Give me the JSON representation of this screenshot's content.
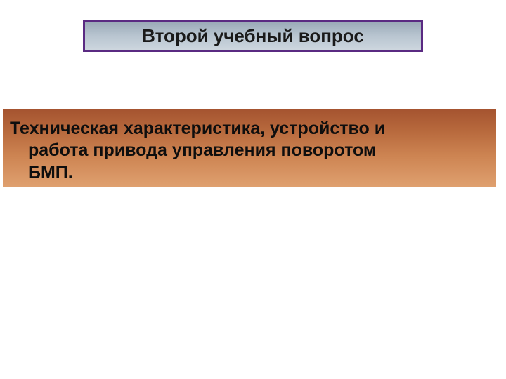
{
  "title": "Второй учебный вопрос",
  "body_line1": "Техническая характеристика, устройство и",
  "body_line2": "работа привода управления поворотом",
  "body_line3": "БМП."
}
